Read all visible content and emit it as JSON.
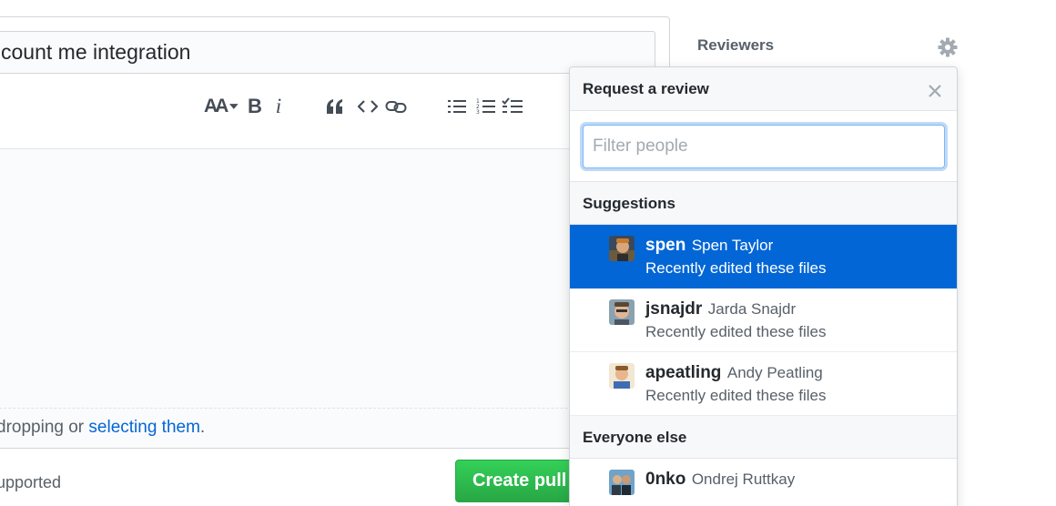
{
  "form": {
    "title_value": "count me integration",
    "toolbar": {
      "header_label": "AA",
      "bold_label": "B",
      "italic_label": "i"
    },
    "drop_prefix": "dropping or ",
    "drop_link": "selecting them",
    "drop_suffix": ".",
    "supported_text": "upported",
    "create_button_label": "Create pull request"
  },
  "sidebar": {
    "reviewers_title": "Reviewers",
    "gear_icon": "gear-icon"
  },
  "popover": {
    "title": "Request a review",
    "filter_placeholder": "Filter people",
    "suggestions_heading": "Suggestions",
    "everyone_else_heading": "Everyone else",
    "suggestions": [
      {
        "login": "spen",
        "name": "Spen Taylor",
        "note": "Recently edited these files",
        "selected": true
      },
      {
        "login": "jsnajdr",
        "name": "Jarda Snajdr",
        "note": "Recently edited these files",
        "selected": false
      },
      {
        "login": "apeatling",
        "name": "Andy Peatling",
        "note": "Recently edited these files",
        "selected": false
      }
    ],
    "others": [
      {
        "login": "0nko",
        "name": "Ondrej Ruttkay"
      }
    ]
  },
  "colors": {
    "accent_blue": "#0366d6",
    "create_green": "#28a745"
  }
}
